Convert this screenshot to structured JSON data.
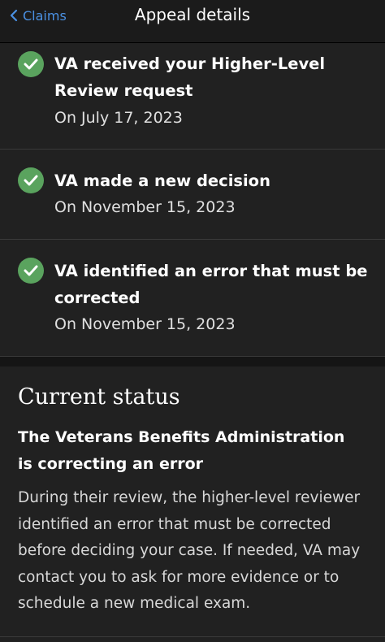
{
  "header": {
    "back_label": "Claims",
    "title": "Appeal details"
  },
  "events": [
    {
      "title": "VA received your Higher-Level Review request",
      "date": "On July 17, 2023",
      "icon": "check-icon"
    },
    {
      "title": "VA made a new decision",
      "date": "On November 15, 2023",
      "icon": "check-icon"
    },
    {
      "title": "VA identified an error that must be corrected",
      "date": "On November 15, 2023",
      "icon": "check-icon"
    }
  ],
  "current_status": {
    "heading": "Current status",
    "subheading": "The Veterans Benefits Administration is correcting an error",
    "body": "During their review, the higher-level reviewer identified an error that must be corrected before deciding your case. If needed, VA may contact you to ask for more evidence or to schedule a new medical exam."
  },
  "colors": {
    "accent": "#4a90e2",
    "success": "#5aa35e",
    "background": "#212121"
  }
}
